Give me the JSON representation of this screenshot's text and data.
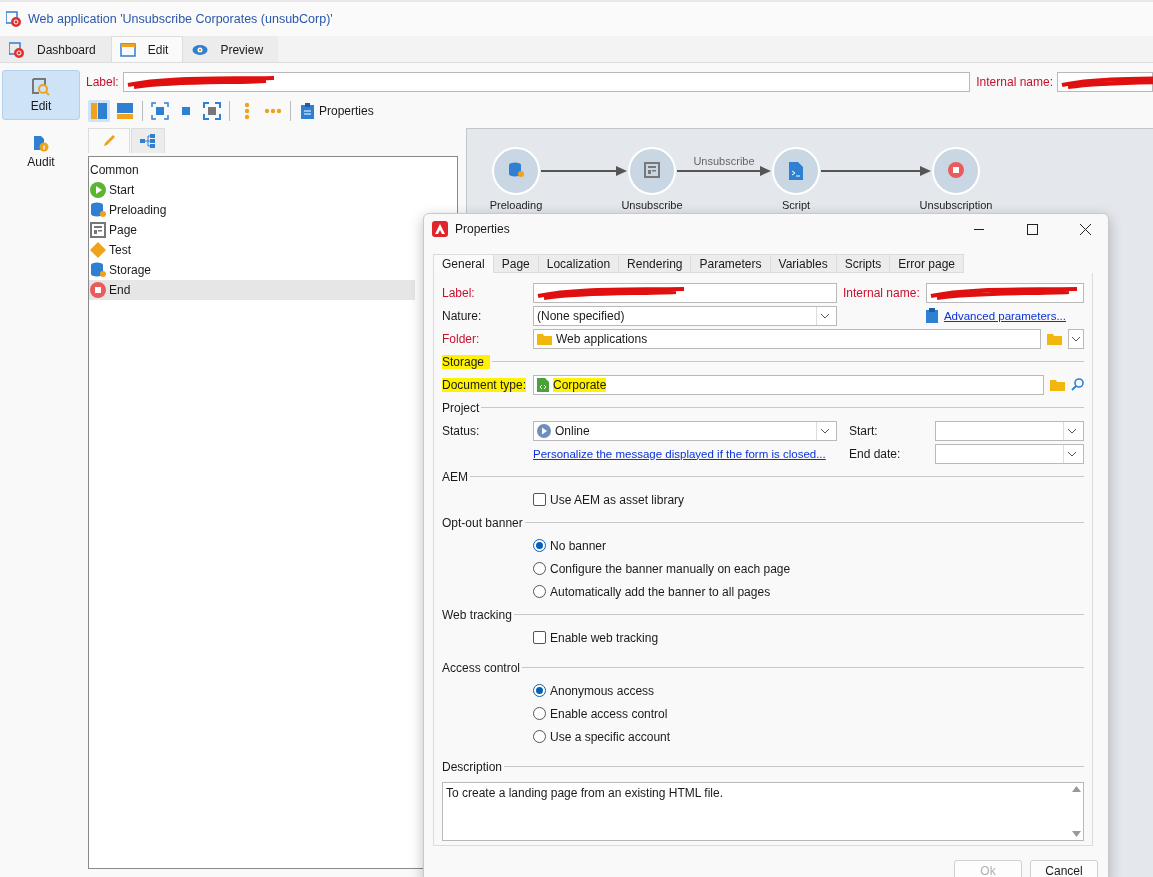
{
  "window": {
    "title": "Web application 'Unsubscribe Corporates (unsubCorp)'"
  },
  "tabs": [
    {
      "label": "Dashboard",
      "kind": "app",
      "selected": false
    },
    {
      "label": "Edit",
      "kind": "edit",
      "selected": true
    },
    {
      "label": "Preview",
      "kind": "preview",
      "selected": false
    }
  ],
  "sidebar": {
    "items": [
      {
        "label": "Edit",
        "kind": "edit",
        "selected": true
      },
      {
        "label": "Audit",
        "kind": "audit",
        "selected": false
      }
    ]
  },
  "header": {
    "label_caption": "Label:",
    "label_redacted": true,
    "internal_name_caption": "Internal name:",
    "internal_name_redacted": true
  },
  "toolbar": {
    "properties": "Properties"
  },
  "palette": {
    "tabs": [
      {
        "kind": "pencil",
        "selected": true
      },
      {
        "kind": "tree",
        "selected": false
      }
    ],
    "group": "Common",
    "items": [
      {
        "label": "Start",
        "kind": "start",
        "selected": false
      },
      {
        "label": "Preloading",
        "kind": "preload",
        "selected": false
      },
      {
        "label": "Page",
        "kind": "page",
        "selected": false
      },
      {
        "label": "Test",
        "kind": "test",
        "selected": false
      },
      {
        "label": "Storage",
        "kind": "storage",
        "selected": false
      },
      {
        "label": "End",
        "kind": "end",
        "selected": true
      }
    ]
  },
  "diagram": {
    "nodes": [
      {
        "label": "Preloading",
        "kind": "preload"
      },
      {
        "label": "Unsubscribe",
        "kind": "page",
        "out_label": "Unsubscribe"
      },
      {
        "label": "Script",
        "kind": "script"
      },
      {
        "label": "Unsubscription",
        "kind": "end"
      }
    ]
  },
  "dialog": {
    "title": "Properties",
    "tabs": [
      {
        "label": "General",
        "selected": true
      },
      {
        "label": "Page",
        "selected": false
      },
      {
        "label": "Localization",
        "selected": false
      },
      {
        "label": "Rendering",
        "selected": false
      },
      {
        "label": "Parameters",
        "selected": false
      },
      {
        "label": "Variables",
        "selected": false
      },
      {
        "label": "Scripts",
        "selected": false
      },
      {
        "label": "Error page",
        "selected": false
      }
    ],
    "label_field": {
      "caption": "Label:",
      "required": true,
      "redacted": true
    },
    "internal_name_field": {
      "caption": "Internal name:",
      "required": true,
      "redacted": true
    },
    "nature": {
      "caption": "Nature:",
      "required": false,
      "value": "(None specified)"
    },
    "advanced_link": "Advanced parameters...",
    "folder": {
      "caption": "Folder:",
      "required": true,
      "value": "Web applications"
    },
    "storage": {
      "title": "Storage",
      "highlighted": true,
      "document_type": {
        "caption": "Document type:",
        "highlighted": true,
        "value": "Corporate"
      }
    },
    "project": {
      "title": "Project",
      "status": {
        "caption": "Status:",
        "value": "Online"
      },
      "start": {
        "caption": "Start:"
      },
      "end_date": {
        "caption": "End date:"
      },
      "closed_link": "Personalize the message displayed if the form is closed..."
    },
    "sections": [
      {
        "title": "AEM",
        "options": [
          {
            "kind": "checkbox",
            "label": "Use AEM as asset library",
            "checked": false
          }
        ]
      },
      {
        "title": "Opt-out banner",
        "options": [
          {
            "kind": "radio",
            "label": "No banner",
            "selected": true
          },
          {
            "kind": "radio",
            "label": "Configure the banner manually on each page",
            "selected": false
          },
          {
            "kind": "radio",
            "label": "Automatically add the banner to all pages",
            "selected": false
          }
        ]
      },
      {
        "title": "Web tracking",
        "options": [
          {
            "kind": "checkbox",
            "label": "Enable web tracking",
            "checked": false
          }
        ]
      },
      {
        "title": "Access control",
        "options": [
          {
            "kind": "radio",
            "label": "Anonymous access",
            "selected": true
          },
          {
            "kind": "radio",
            "label": "Enable access control",
            "selected": false
          },
          {
            "kind": "radio",
            "label": "Use a specific account",
            "selected": false
          }
        ]
      }
    ],
    "description": {
      "title": "Description",
      "value": "To create a landing page from an existing HTML file."
    },
    "buttons": [
      {
        "label": "Ok",
        "disabled": true
      },
      {
        "label": "Cancel",
        "disabled": false
      }
    ]
  }
}
